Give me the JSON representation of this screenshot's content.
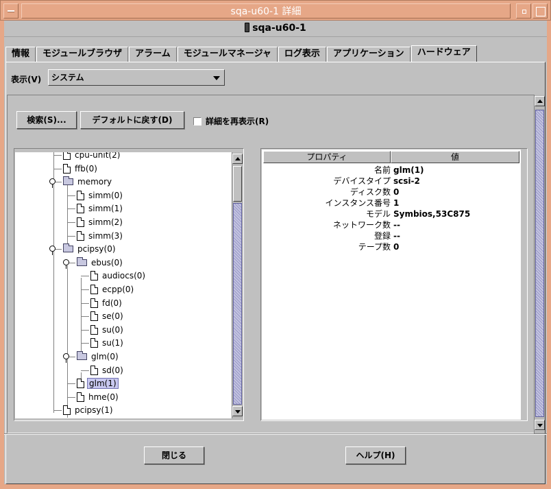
{
  "window": {
    "title": "sqa-u60-1 詳細"
  },
  "header": {
    "host": "sqa-u60-1"
  },
  "tabs": [
    {
      "label": "情報",
      "active": false
    },
    {
      "label": "モジュールブラウザ",
      "active": false
    },
    {
      "label": "アラーム",
      "active": false
    },
    {
      "label": "モジュールマネージャ",
      "active": false
    },
    {
      "label": "ログ表示",
      "active": false
    },
    {
      "label": "アプリケーション",
      "active": false
    },
    {
      "label": "ハードウェア",
      "active": true
    }
  ],
  "view": {
    "label": "表示(V)",
    "selected": "システム"
  },
  "toolbar": {
    "search_label": "検索(S)...",
    "default_label": "デフォルトに戻す(D)",
    "redisplay_label": "詳細を再表示(R)",
    "redisplay_checked": false
  },
  "tree": {
    "nodes": [
      {
        "label": "cpu-unit(2)",
        "type": "doc"
      },
      {
        "label": "ffb(0)",
        "type": "doc"
      },
      {
        "label": "memory",
        "type": "folder",
        "expanded": true
      },
      {
        "label": "simm(0)",
        "type": "doc"
      },
      {
        "label": "simm(1)",
        "type": "doc"
      },
      {
        "label": "simm(2)",
        "type": "doc"
      },
      {
        "label": "simm(3)",
        "type": "doc"
      },
      {
        "label": "pcipsy(0)",
        "type": "folder",
        "expanded": true
      },
      {
        "label": "ebus(0)",
        "type": "folder",
        "expanded": true
      },
      {
        "label": "audiocs(0)",
        "type": "doc"
      },
      {
        "label": "ecpp(0)",
        "type": "doc"
      },
      {
        "label": "fd(0)",
        "type": "doc"
      },
      {
        "label": "se(0)",
        "type": "doc"
      },
      {
        "label": "su(0)",
        "type": "doc"
      },
      {
        "label": "su(1)",
        "type": "doc"
      },
      {
        "label": "glm(0)",
        "type": "folder",
        "expanded": true
      },
      {
        "label": "sd(0)",
        "type": "doc"
      },
      {
        "label": "glm(1)",
        "type": "doc",
        "selected": true
      },
      {
        "label": "hme(0)",
        "type": "doc"
      },
      {
        "label": "pcipsy(1)",
        "type": "doc"
      }
    ]
  },
  "properties": {
    "col_property": "プロパティ",
    "col_value": "値",
    "rows": [
      {
        "key": "名前",
        "value": "glm(1)"
      },
      {
        "key": "デバイスタイプ",
        "value": "scsi-2"
      },
      {
        "key": "ディスク数",
        "value": "0"
      },
      {
        "key": "インスタンス番号",
        "value": "1"
      },
      {
        "key": "モデル",
        "value": "Symbios,53C875"
      },
      {
        "key": "ネットワーク数",
        "value": "--"
      },
      {
        "key": "登録",
        "value": "--"
      },
      {
        "key": "テープ数",
        "value": "0"
      }
    ]
  },
  "footer": {
    "close_label": "閉じる",
    "help_label": "ヘルプ(H)"
  }
}
